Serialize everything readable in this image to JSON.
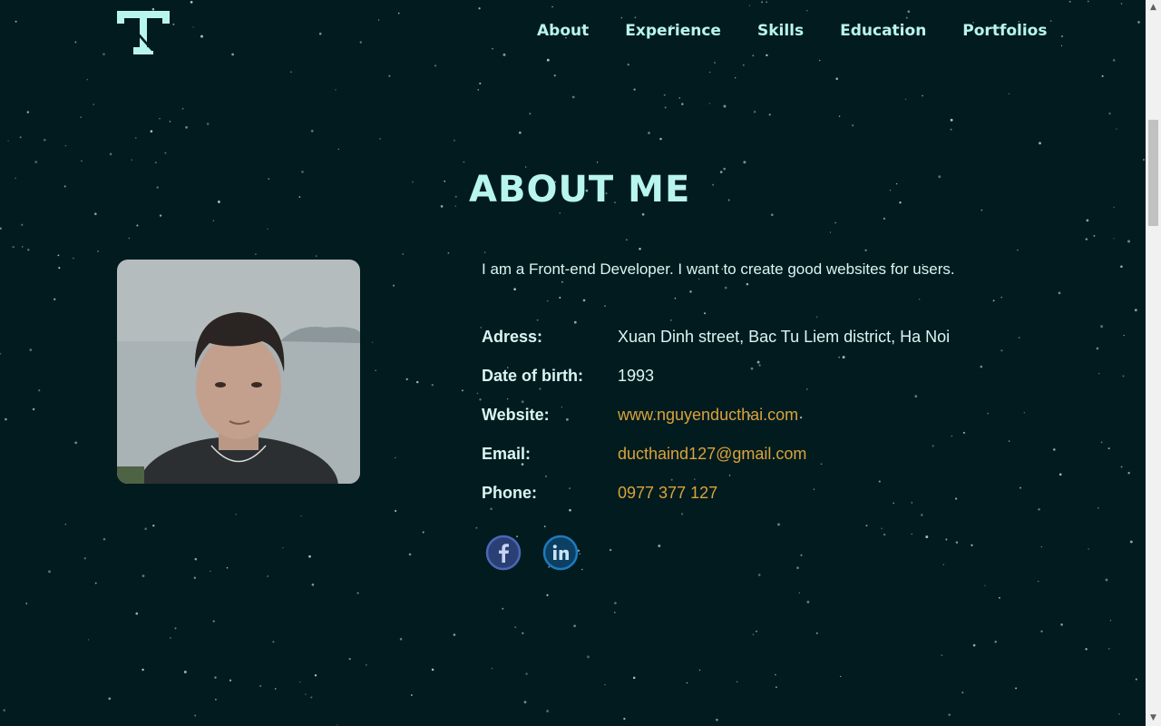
{
  "nav": {
    "items": [
      "About",
      "Experience",
      "Skills",
      "Education",
      "Portfolios"
    ]
  },
  "about": {
    "title": "ABOUT ME",
    "intro": "I am a Front-end Developer. I want to create good websites for users.",
    "details": [
      {
        "label": "Adress:",
        "value": "Xuan Dinh street, Bac Tu Liem district, Ha Noi",
        "link": false
      },
      {
        "label": "Date of birth:",
        "value": "1993",
        "link": false
      },
      {
        "label": "Website:",
        "value": "www.nguyenducthai.com",
        "link": true
      },
      {
        "label": "Email:",
        "value": "ducthaind127@gmail.com",
        "link": true
      },
      {
        "label": "Phone:",
        "value": "0977 377 127",
        "link": true
      }
    ],
    "social": [
      "facebook-icon",
      "linkedin-icon"
    ]
  },
  "colors": {
    "background": "#021b1f",
    "accent": "#b8f5ee",
    "link": "#d9a33a"
  }
}
